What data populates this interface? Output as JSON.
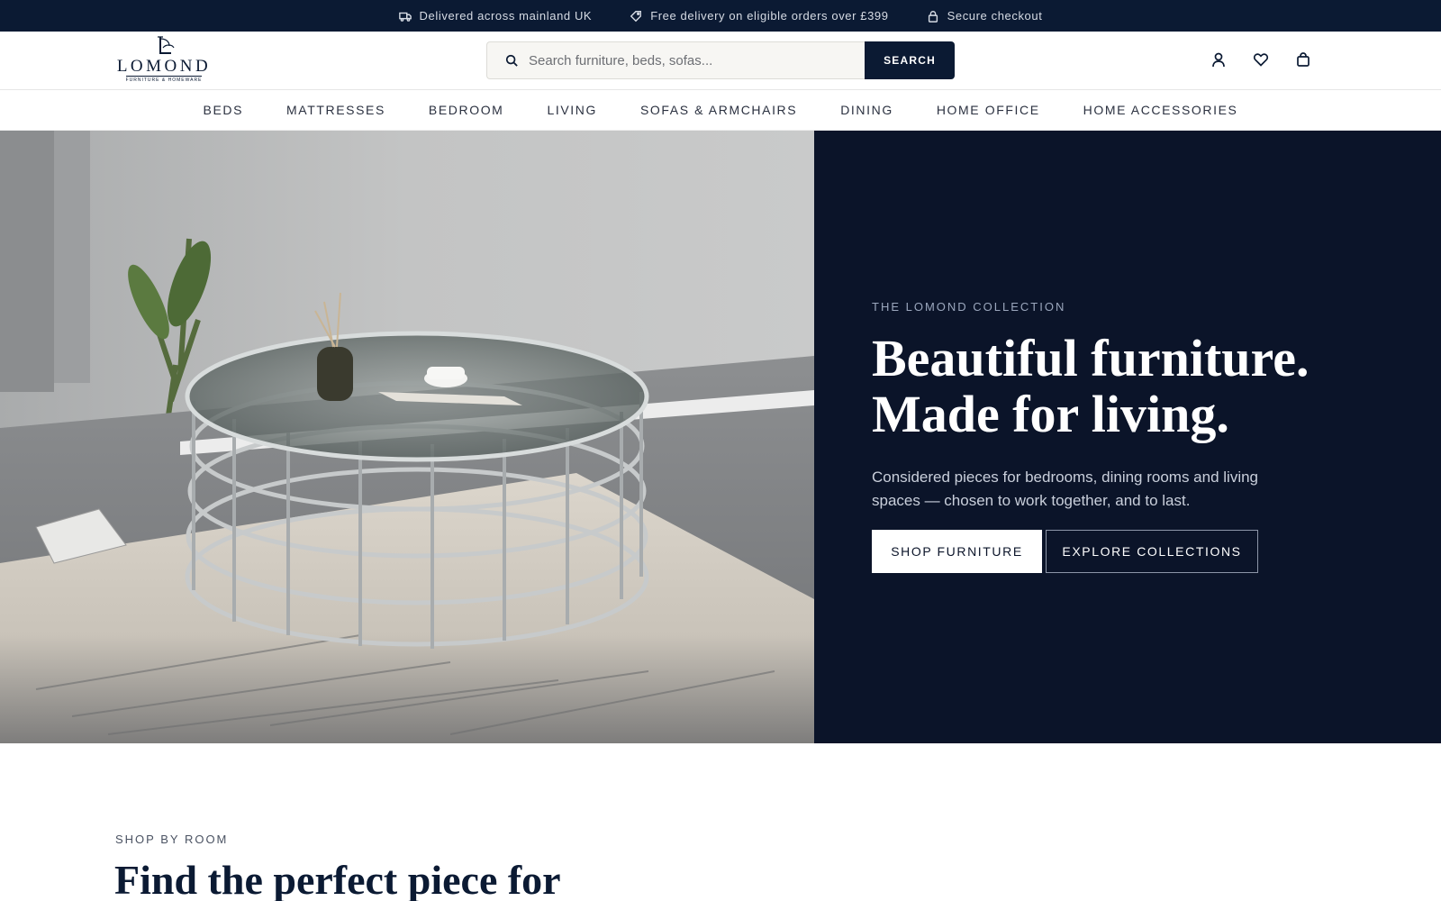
{
  "topbar": {
    "items": [
      {
        "icon": "truck-icon",
        "text": "Delivered across mainland UK"
      },
      {
        "icon": "tag-icon",
        "text": "Free delivery on eligible orders over £399"
      },
      {
        "icon": "lock-icon",
        "text": "Secure checkout"
      }
    ]
  },
  "header": {
    "logo": {
      "name": "LOMOND",
      "tagline": "FURNITURE & HOMEWARE"
    },
    "search": {
      "placeholder": "Search furniture, beds, sofas...",
      "button_label": "SEARCH"
    },
    "icons": [
      "account-icon",
      "wishlist-heart-icon",
      "shopping-bag-icon"
    ]
  },
  "nav": {
    "items": [
      "BEDS",
      "MATTRESSES",
      "BEDROOM",
      "LIVING",
      "SOFAS & ARMCHAIRS",
      "DINING",
      "HOME OFFICE",
      "HOME ACCESSORIES"
    ]
  },
  "hero": {
    "eyebrow": "THE LOMOND COLLECTION",
    "headline_line1": "Beautiful furniture.",
    "headline_line2": "Made for living.",
    "subtext": "Considered pieces for bedrooms, dining rooms and living spaces — chosen to work together, and to last.",
    "primary_cta": "SHOP FURNITURE",
    "secondary_cta": "EXPLORE COLLECTIONS",
    "image_subject": "round-glass-coffee-table-photo"
  },
  "shop_by_room": {
    "eyebrow": "SHOP BY ROOM",
    "title": "Find the perfect piece for"
  },
  "colors": {
    "navy": "#0b1a33",
    "hero_panel": "#0b1429",
    "white": "#ffffff"
  }
}
